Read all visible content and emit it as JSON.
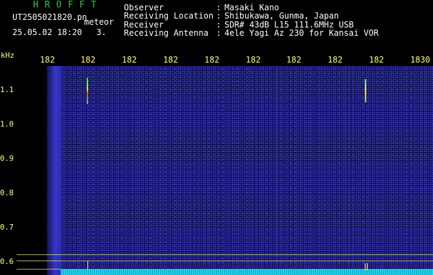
{
  "header": {
    "app_title": "HROFFT",
    "file_name": "UT2505021820.pn",
    "meteor_tag": "meteor",
    "datetime": "25.05.02 18:20",
    "count": "3."
  },
  "station_info": [
    {
      "label": "Observer",
      "value": "Masaki Kano"
    },
    {
      "label": "Receiving Location",
      "value": "Shibukawa, Gunma, Japan"
    },
    {
      "label": "Receiver",
      "value": "SDR# 43dB L15 111.6MHz USB"
    },
    {
      "label": "Receiving Antenna",
      "value": "4ele Yagi Az 230 for Kansai VOR"
    }
  ],
  "axes": {
    "y_unit": "kHz",
    "y_ticks": [
      "1.1",
      "1.0",
      "0.9",
      "0.8",
      "0.7",
      "0.6"
    ],
    "x_ticks": [
      "182",
      "182",
      "182",
      "182",
      "182",
      "182",
      "182",
      "182",
      "182",
      "1830"
    ]
  },
  "colors": {
    "title": "#36c536",
    "axis_text": "#ffff7a",
    "background": "#0b0b40",
    "spectrum": "#19c4df"
  }
}
